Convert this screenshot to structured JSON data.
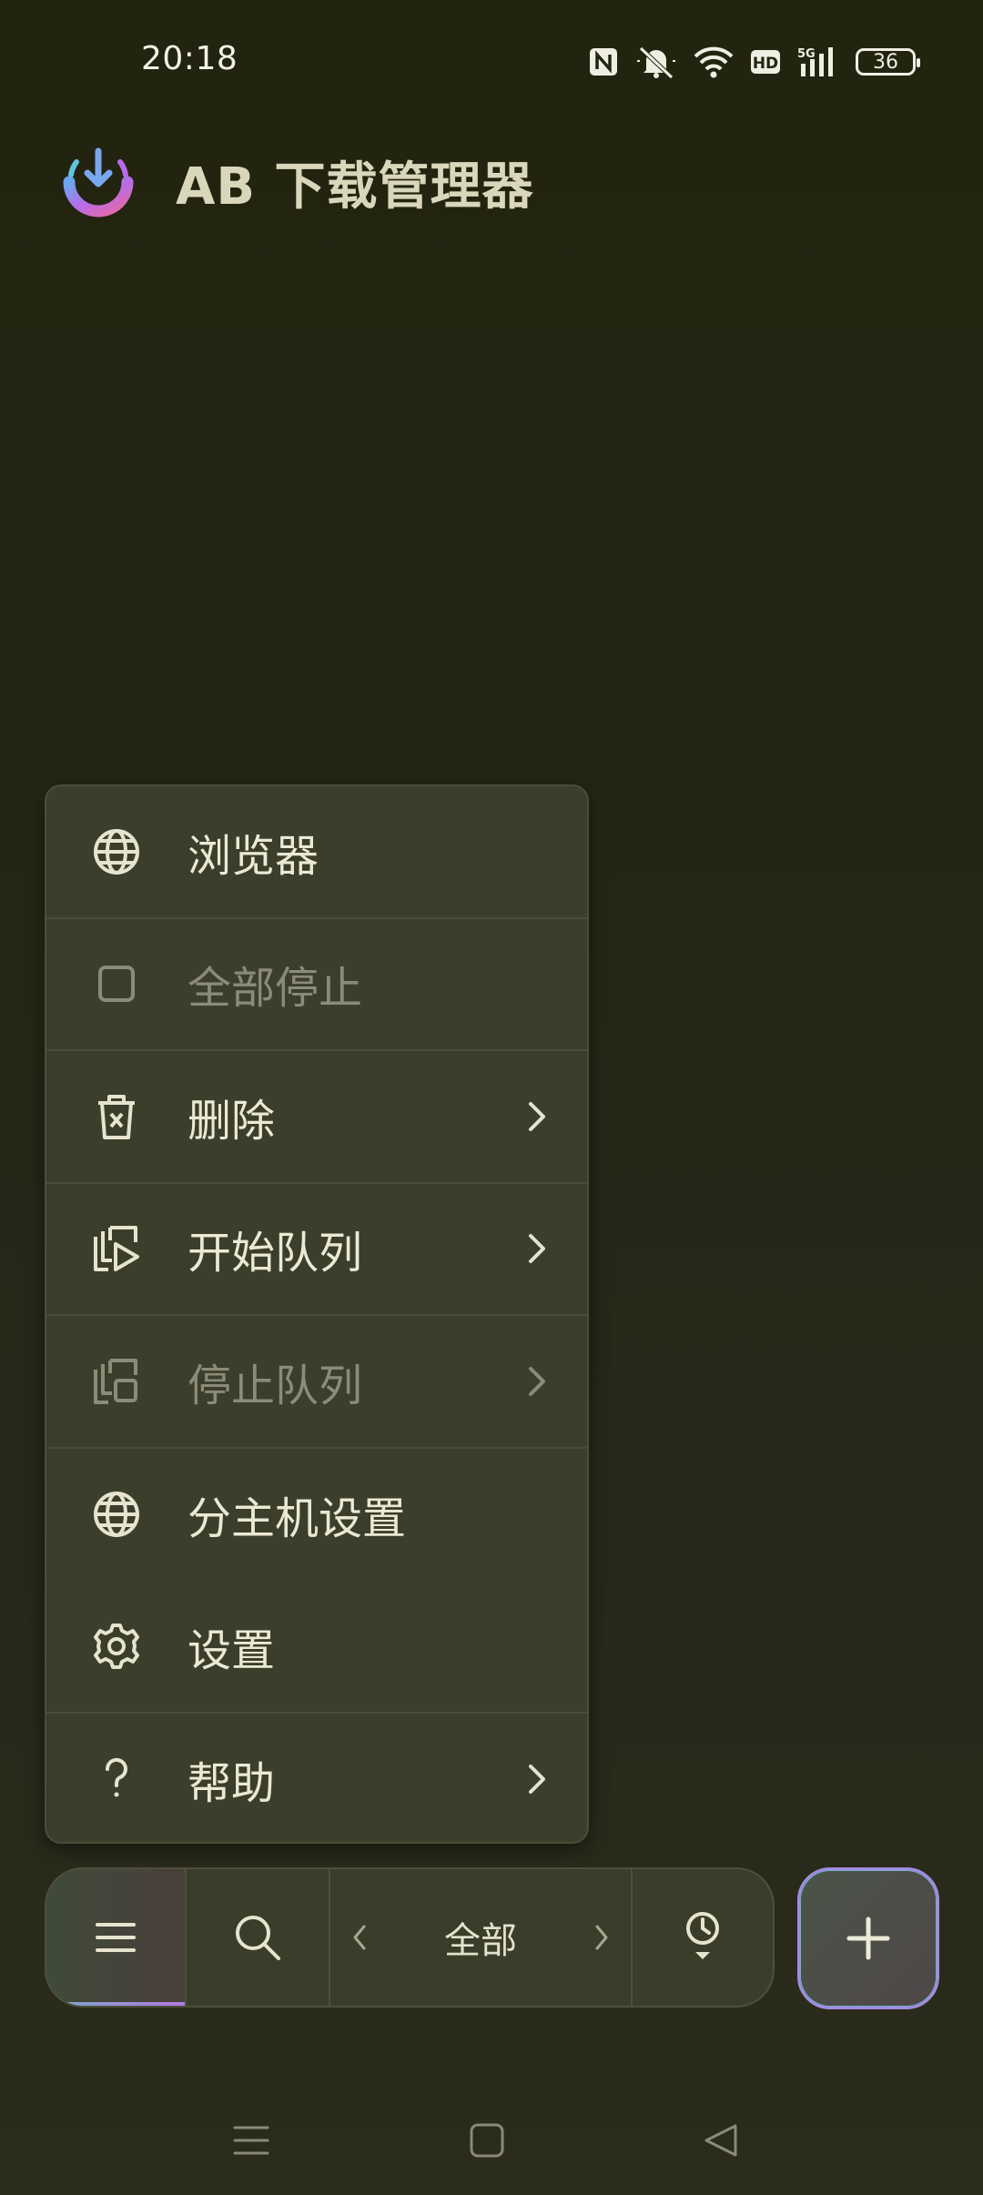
{
  "status_bar": {
    "time": "20:18",
    "battery": "36"
  },
  "app": {
    "title": "AB 下载管理器"
  },
  "menu": {
    "items": [
      {
        "label": "浏览器",
        "icon": "globe-icon",
        "disabled": false,
        "has_submenu": false
      },
      {
        "label": "全部停止",
        "icon": "stop-square-icon",
        "disabled": true,
        "has_submenu": false
      },
      {
        "label": "删除",
        "icon": "trash-icon",
        "disabled": false,
        "has_submenu": true
      },
      {
        "label": "开始队列",
        "icon": "queue-play-icon",
        "disabled": false,
        "has_submenu": true
      },
      {
        "label": "停止队列",
        "icon": "queue-stop-icon",
        "disabled": true,
        "has_submenu": true
      },
      {
        "label": "分主机设置",
        "icon": "globe-icon",
        "disabled": false,
        "has_submenu": false
      },
      {
        "label": "设置",
        "icon": "gear-icon",
        "disabled": false,
        "has_submenu": false
      },
      {
        "label": "帮助",
        "icon": "help-icon",
        "disabled": false,
        "has_submenu": true
      }
    ]
  },
  "toolbar": {
    "filter_label": "全部"
  },
  "colors": {
    "background": "#252714",
    "menu_bg": "#3b3e2b",
    "accent_purple": "#a38be0",
    "accent_blue": "#6fb0d0"
  }
}
